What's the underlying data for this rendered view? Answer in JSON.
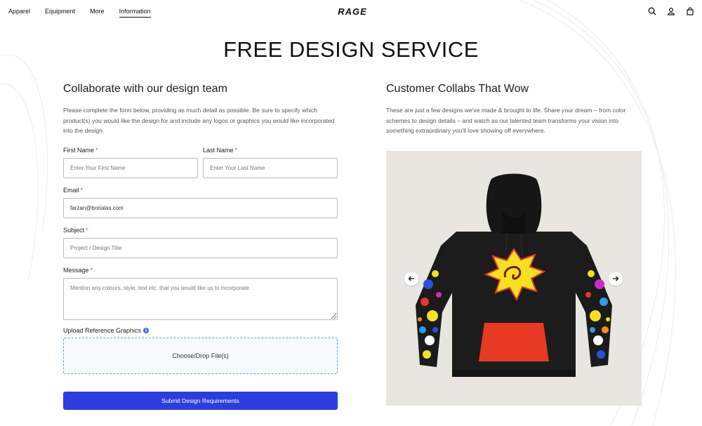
{
  "nav": {
    "links": [
      "Apparel",
      "Equipment",
      "More",
      "Information"
    ],
    "active": "Information",
    "logo_text": "RAGE",
    "icons": [
      "search-icon",
      "account-icon",
      "cart-icon"
    ]
  },
  "page": {
    "title": "FREE DESIGN SERVICE"
  },
  "form": {
    "heading": "Collaborate with our design team",
    "intro": "Please complete the form below, providing as much detail as possible. Be sure to specify which product(s) you would like the design for and include any logos or graphics you would like incorporated into the design.",
    "required_mark": "*",
    "first_name": {
      "label": "First Name",
      "placeholder": "Enter Your First Name",
      "value": ""
    },
    "last_name": {
      "label": "Last Name",
      "placeholder": "Enter Your Last Name",
      "value": ""
    },
    "email": {
      "label": "Email",
      "placeholder": "",
      "value": "farzan@borialas.com"
    },
    "subject": {
      "label": "Subject",
      "placeholder": "Project / Design Title",
      "value": ""
    },
    "message": {
      "label": "Message",
      "placeholder": "Mention any colours, style, text etc. that you would like us to incorporate.",
      "value": ""
    },
    "upload": {
      "label": "Upload Reference Graphics",
      "info": "i",
      "dropzone_text": "Choose/Drop File(s)"
    },
    "submit_label": "Submit Design Requirements"
  },
  "showcase": {
    "heading": "Customer Collabs That Wow",
    "intro": "These are just a few designs we've made & brought to life. Share your dream – from color schemes to design details – and watch as our talented team transforms your vision into something extraordinary you'll love showing off everywhere.",
    "prev_icon": "arrow-left-icon",
    "next_icon": "arrow-right-icon"
  },
  "colors": {
    "accent": "#2c3ddc",
    "required": "#d9534f",
    "carousel_bg": "#e7e6e0",
    "dropzone_border": "#6aa5d8"
  }
}
